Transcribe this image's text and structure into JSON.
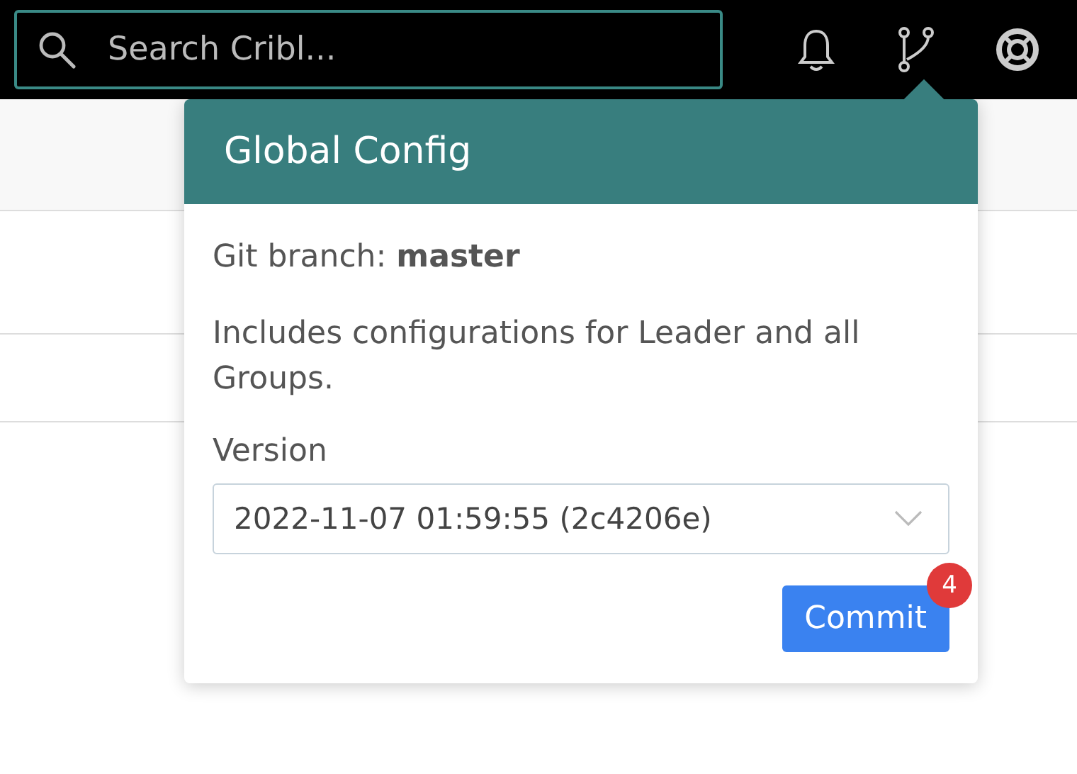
{
  "top_bar": {
    "search": {
      "placeholder": "Search Cribl..."
    }
  },
  "popover": {
    "title": "Global Config",
    "branch_line": "Git branch: **master**",
    "description": "Includes configurations for Leader and all Groups.",
    "version": {
      "label": "Version",
      "value": "2022-11-07 01:59:55 (2c4206e)"
    },
    "commit_button": {
      "label": "Commit",
      "badge": "4"
    }
  }
}
